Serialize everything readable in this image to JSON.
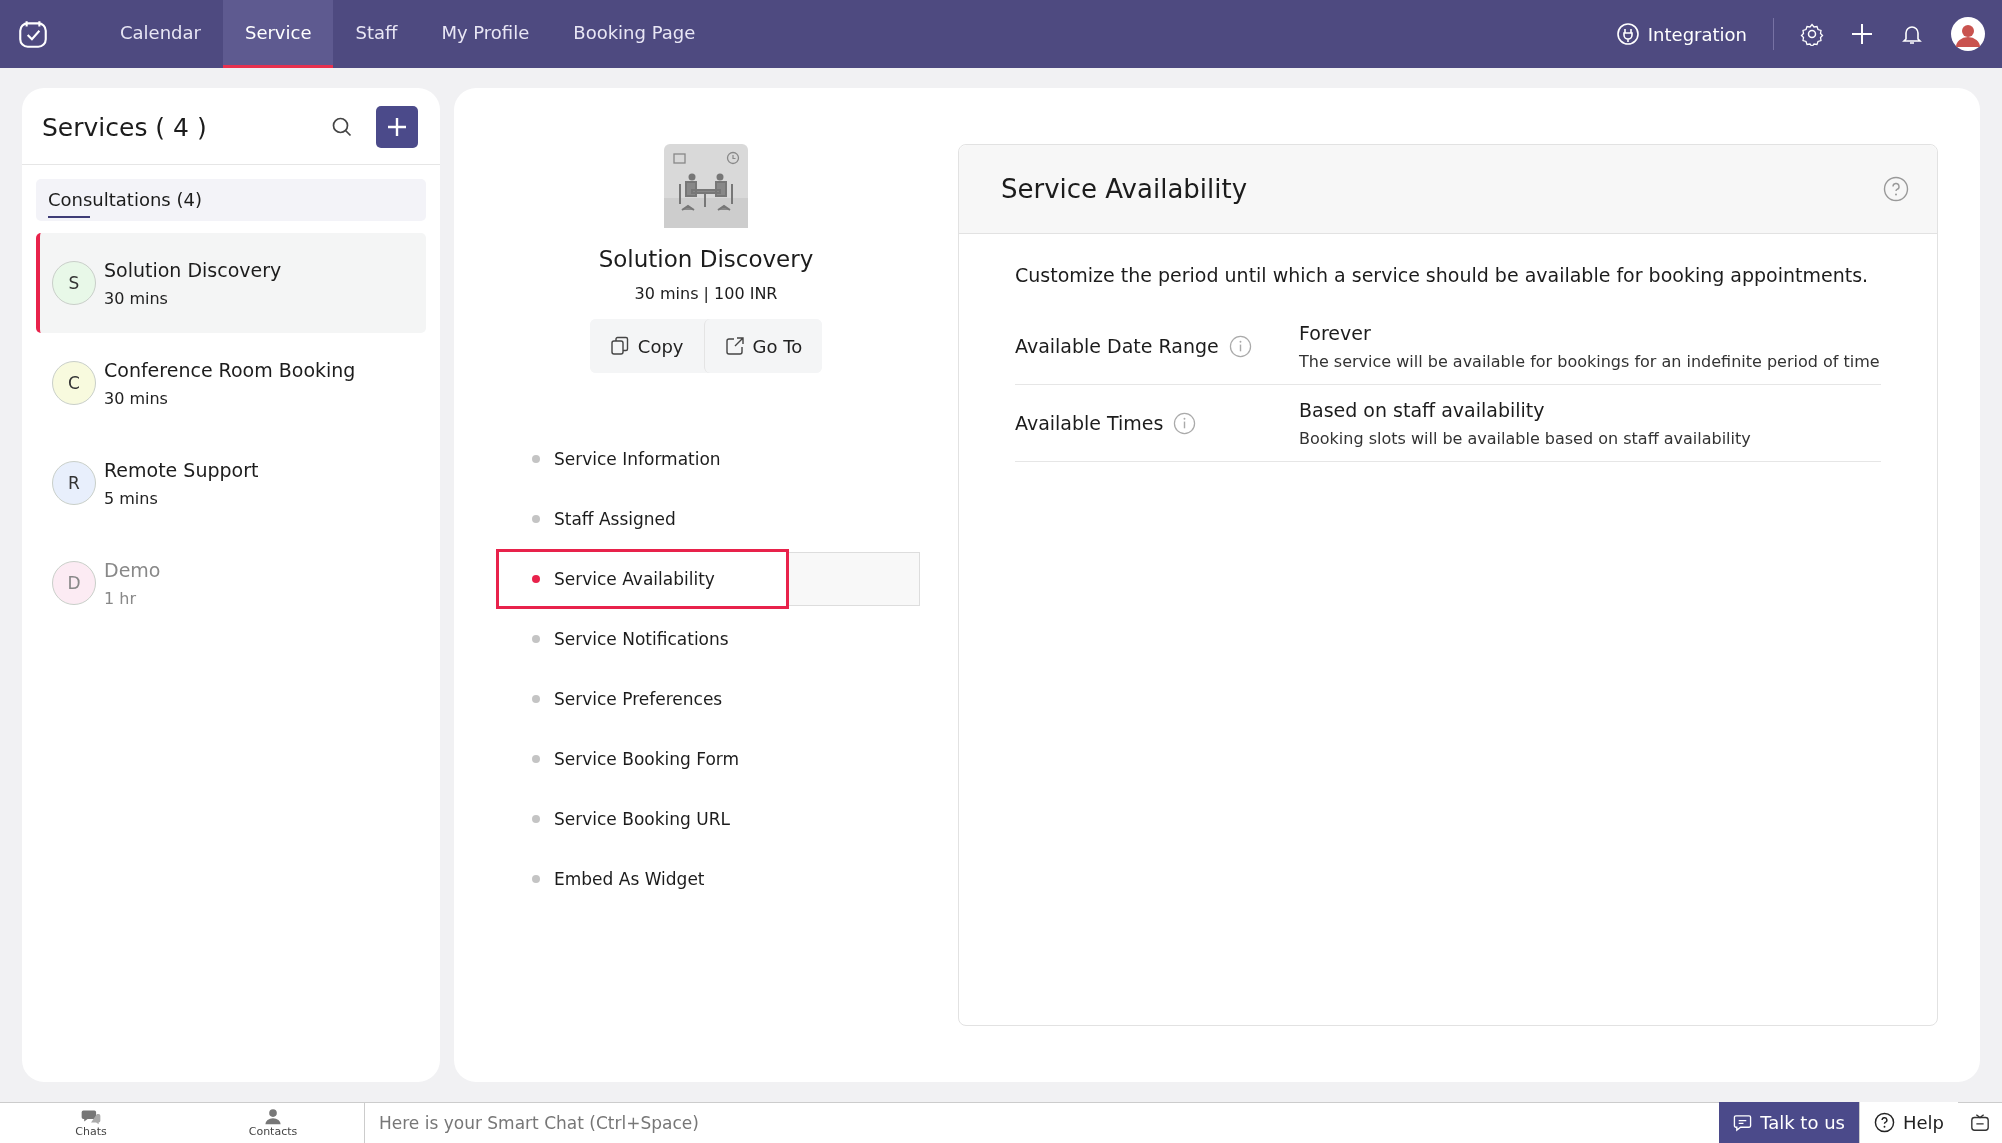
{
  "topbar": {
    "nav": [
      {
        "label": "Calendar",
        "selected": false
      },
      {
        "label": "Service",
        "selected": true
      },
      {
        "label": "Staff",
        "selected": false
      },
      {
        "label": "My Profile",
        "selected": false
      },
      {
        "label": "Booking Page",
        "selected": false
      }
    ],
    "integration": "Integration"
  },
  "services": {
    "title": "Services ( 4 )",
    "category": "Consultations (4)",
    "items": [
      {
        "initial": "S",
        "name": "Solution Discovery",
        "duration": "30 mins",
        "selected": true,
        "inactive": false,
        "color": "#e8f8e8"
      },
      {
        "initial": "C",
        "name": "Conference Room Booking",
        "duration": "30 mins",
        "selected": false,
        "inactive": false,
        "color": "#f8fade"
      },
      {
        "initial": "R",
        "name": "Remote Support",
        "duration": "5 mins",
        "selected": false,
        "inactive": false,
        "color": "#e8effc"
      },
      {
        "initial": "D",
        "name": "Demo",
        "duration": "1 hr",
        "selected": false,
        "inactive": true,
        "color": "#fcebf3"
      }
    ]
  },
  "detail": {
    "name": "Solution Discovery",
    "meta": "30 mins | 100 INR",
    "actions": [
      {
        "kind": "copy",
        "label": "Copy"
      },
      {
        "kind": "goto",
        "label": "Go To"
      }
    ],
    "menu": [
      {
        "label": "Service Information",
        "selected": false
      },
      {
        "label": "Staff Assigned",
        "selected": false
      },
      {
        "label": "Service Availability",
        "selected": true
      },
      {
        "label": "Service Notifications",
        "selected": false
      },
      {
        "label": "Service Preferences",
        "selected": false
      },
      {
        "label": "Service Booking Form",
        "selected": false
      },
      {
        "label": "Service Booking URL",
        "selected": false
      },
      {
        "label": "Embed As Widget",
        "selected": false
      }
    ]
  },
  "availability": {
    "title": "Service Availability",
    "description": "Customize the period until which a service should be available for booking appointments.",
    "rows": [
      {
        "label": "Available Date Range",
        "value": "Forever",
        "note": "The service will be available for bookings for an indefinite period of time"
      },
      {
        "label": "Available Times",
        "value": "Based on staff availability",
        "note": "Booking slots will be available based on staff availability"
      }
    ]
  },
  "bottombar": {
    "chats": "Chats",
    "contacts": "Contacts",
    "placeholder": "Here is your Smart Chat (Ctrl+Space)",
    "talk": "Talk to us",
    "help": "Help"
  }
}
